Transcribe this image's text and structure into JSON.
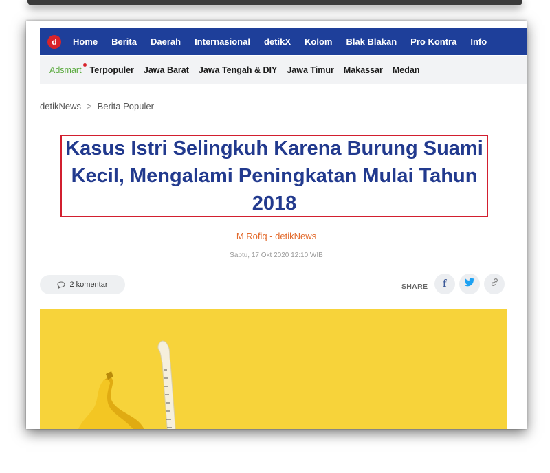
{
  "nav": {
    "logo_letter": "d",
    "items": [
      "Home",
      "Berita",
      "Daerah",
      "Internasional",
      "detikX",
      "Kolom",
      "Blak Blakan",
      "Pro Kontra",
      "Info"
    ]
  },
  "subnav": {
    "adsmart": "Adsmart",
    "items": [
      "Terpopuler",
      "Jawa Barat",
      "Jawa Tengah & DIY",
      "Jawa Timur",
      "Makassar",
      "Medan"
    ]
  },
  "breadcrumb": {
    "root": "detikNews",
    "separator": ">",
    "current": "Berita Populer"
  },
  "article": {
    "headline": "Kasus Istri Selingkuh Karena Burung Suami Kecil, Mengalami Peningkatan Mulai Tahun 2018",
    "author": "M Rofiq - detikNews",
    "date": "Sabtu, 17 Okt 2020 12:10 WIB",
    "comments": "2 komentar"
  },
  "share": {
    "label": "SHARE",
    "facebook_glyph": "f",
    "twitter_glyph": "t",
    "link_glyph": "🔗"
  },
  "colors": {
    "navbar": "#1e3f9a",
    "headline": "#223a8e",
    "highlight_border": "#d21f2f",
    "author": "#e26a2c",
    "hero_background": "#f7d33a",
    "facebook": "#3b5998",
    "twitter": "#1da1f2"
  },
  "icons": {
    "logo": "detik-logo-icon",
    "comment": "comment-bubble-icon",
    "facebook": "facebook-icon",
    "twitter": "twitter-icon",
    "link": "link-icon",
    "breadcrumb_separator": "chevron-right-icon"
  }
}
